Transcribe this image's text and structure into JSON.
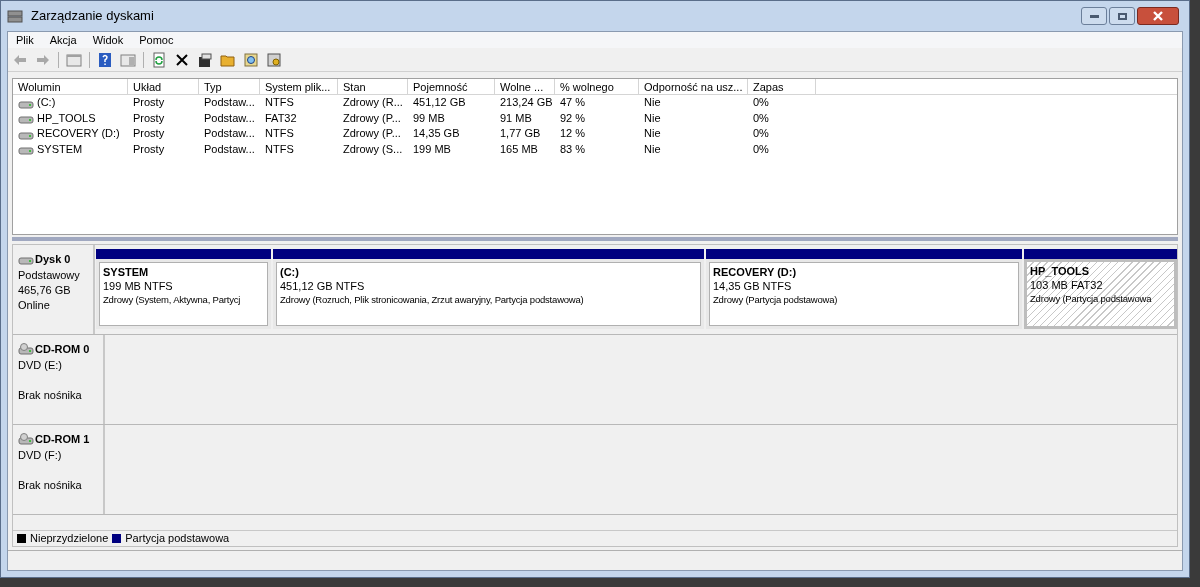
{
  "window": {
    "title": "Zarządzanie dyskami"
  },
  "menu": [
    "Plik",
    "Akcja",
    "Widok",
    "Pomoc"
  ],
  "table": {
    "columns": [
      "Wolumin",
      "Układ",
      "Typ",
      "System plik...",
      "Stan",
      "Pojemność",
      "Wolne ...",
      "% wolnego",
      "Odporność na usz...",
      "Zapas"
    ],
    "rows": [
      [
        "(C:)",
        "Prosty",
        "Podstaw...",
        "NTFS",
        "Zdrowy (R...",
        "451,12 GB",
        "213,24 GB",
        "47 %",
        "Nie",
        "0%"
      ],
      [
        "HP_TOOLS",
        "Prosty",
        "Podstaw...",
        "FAT32",
        "Zdrowy (P...",
        "99 MB",
        "91 MB",
        "92 %",
        "Nie",
        "0%"
      ],
      [
        "RECOVERY (D:)",
        "Prosty",
        "Podstaw...",
        "NTFS",
        "Zdrowy (P...",
        "14,35 GB",
        "1,77 GB",
        "12 %",
        "Nie",
        "0%"
      ],
      [
        "SYSTEM",
        "Prosty",
        "Podstaw...",
        "NTFS",
        "Zdrowy (S...",
        "199 MB",
        "165 MB",
        "83 %",
        "Nie",
        "0%"
      ]
    ]
  },
  "disks": [
    {
      "kind": "disk",
      "name": "Dysk 0",
      "lines": [
        "Podstawowy",
        "465,76 GB",
        "Online"
      ],
      "partitions": [
        {
          "name": "SYSTEM",
          "size": "199 MB NTFS",
          "status": "Zdrowy (System, Aktywna, Partycj",
          "selected": false
        },
        {
          "name": "(C:)",
          "size": "451,12 GB NTFS",
          "status": "Zdrowy (Rozruch, Plik stronicowania, Zrzut awaryjny, Partycja podstawowa)",
          "selected": false
        },
        {
          "name": "RECOVERY  (D:)",
          "size": "14,35 GB NTFS",
          "status": "Zdrowy (Partycja podstawowa)",
          "selected": false
        },
        {
          "name": "HP_TOOLS",
          "size": "103 MB FAT32",
          "status": "Zdrowy (Partycja podstawowa",
          "selected": true
        }
      ]
    },
    {
      "kind": "cdrom",
      "name": "CD-ROM 0",
      "lines": [
        "DVD (E:)",
        "Brak nośnika"
      ]
    },
    {
      "kind": "cdrom",
      "name": "CD-ROM 1",
      "lines": [
        "DVD (F:)",
        "Brak nośnika"
      ]
    }
  ],
  "legend": [
    {
      "label": "Nieprzydzielone",
      "color": "#000000"
    },
    {
      "label": "Partycja podstawowa",
      "color": "#000080"
    }
  ]
}
